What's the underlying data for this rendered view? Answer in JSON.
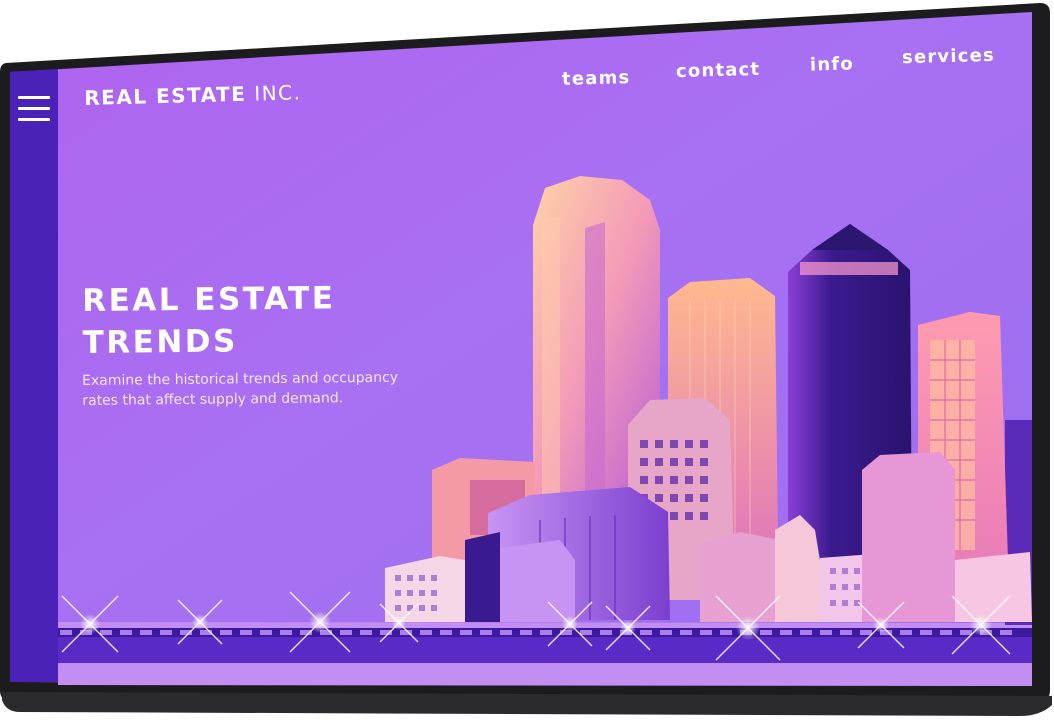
{
  "brand": {
    "bold": "REAL ESTATE",
    "light": "INC."
  },
  "nav": {
    "items": [
      {
        "label": "teams"
      },
      {
        "label": "contact"
      },
      {
        "label": "info"
      },
      {
        "label": "services"
      }
    ]
  },
  "hero": {
    "title_line1": "REAL ESTATE",
    "title_line2": "TRENDS",
    "subtitle": "Examine the historical trends and occupancy rates that affect supply and demand."
  },
  "icons": {
    "menu": "hamburger-menu-icon"
  },
  "colors": {
    "sidebar": "#4a22b8",
    "screen_top": "#a35ff0",
    "screen_bottom": "#b07ef0",
    "accent_pink": "#f0a3d9",
    "bezel": "#1f1f22"
  }
}
